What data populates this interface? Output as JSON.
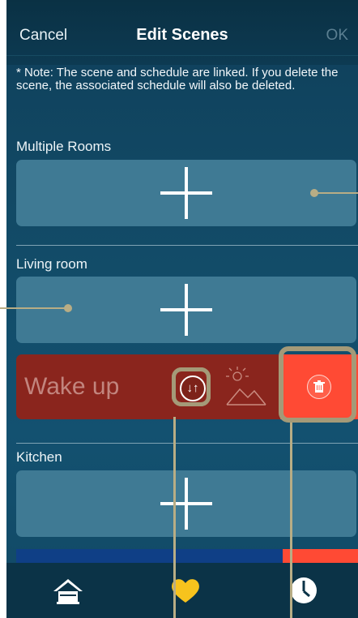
{
  "header": {
    "cancel_label": "Cancel",
    "title": "Edit Scenes",
    "ok_label": "OK"
  },
  "note": "* Note: The scene and schedule are linked. If you delete the scene, the associated schedule will also be deleted.",
  "sections": [
    {
      "label": "Multiple Rooms"
    },
    {
      "label": "Living room",
      "scenes": [
        {
          "name": "Wake up"
        }
      ]
    },
    {
      "label": "Kitchen"
    }
  ],
  "tabs": [
    {
      "icon": "home-icon"
    },
    {
      "icon": "heart-icon"
    },
    {
      "icon": "clock-icon"
    }
  ],
  "colors": {
    "background": "#124a66",
    "card": "#3f7a94",
    "scene_card": "#8a251d",
    "delete": "#ff4a34",
    "callout": "#b8ad85"
  }
}
